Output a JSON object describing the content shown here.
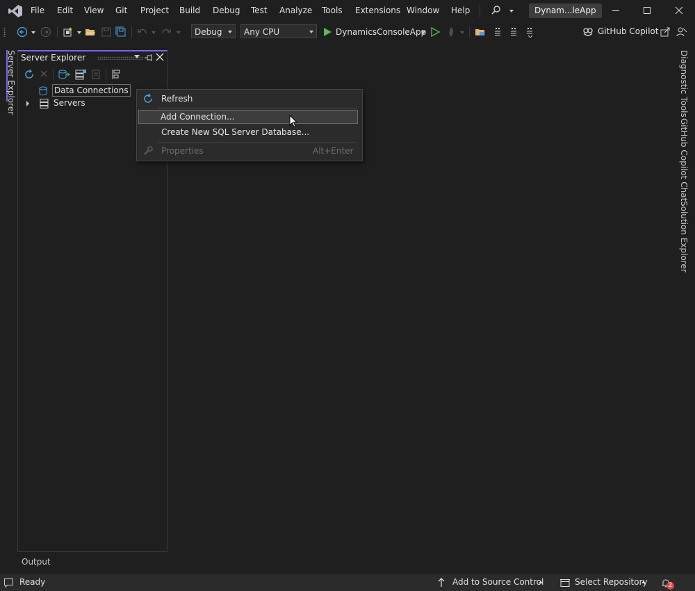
{
  "menu": {
    "items": [
      "File",
      "Edit",
      "View",
      "Git",
      "Project",
      "Build",
      "Debug",
      "Test",
      "Analyze",
      "Tools",
      "Extensions",
      "Window",
      "Help"
    ],
    "solution_name": "Dynam...leApp"
  },
  "toolbar": {
    "config": "Debug",
    "platform": "Any CPU",
    "startup_project": "DynamicsConsoleApp",
    "copilot_label": "GitHub Copilot"
  },
  "left_tabs": {
    "server_explorer": "Server Explorer"
  },
  "server_explorer": {
    "title": "Server Explorer",
    "tree": [
      {
        "label": "Data Connections"
      },
      {
        "label": "Servers"
      }
    ]
  },
  "context_menu": {
    "refresh": "Refresh",
    "add_connection": "Add Connection...",
    "create_db": "Create New SQL Server Database...",
    "properties": "Properties",
    "properties_shortcut": "Alt+Enter"
  },
  "right_tabs": {
    "diagnostic": "Diagnostic Tools",
    "copilot_chat": "GitHub Copilot Chat",
    "solution_explorer": "Solution Explorer"
  },
  "output_tab": "Output",
  "status": {
    "ready": "Ready",
    "add_source": "Add to Source Control",
    "select_repo": "Select Repository",
    "notification_count": "2"
  },
  "colors": {
    "accent": "#7b68ee",
    "run_green": "#5cb85c",
    "vs_purple": "#9b7be0"
  },
  "icons": [
    "vs-logo-icon",
    "search-icon",
    "back-icon",
    "forward-icon",
    "new-project-icon",
    "open-folder-icon",
    "save-icon",
    "save-all-icon",
    "undo-icon",
    "redo-icon",
    "run-icon",
    "run-no-debug-icon",
    "hot-reload-icon",
    "copilot-icon",
    "share-icon",
    "feedback-icon",
    "refresh-icon",
    "database-icon",
    "server-icon",
    "pin-icon",
    "close-icon",
    "bell-icon"
  ]
}
